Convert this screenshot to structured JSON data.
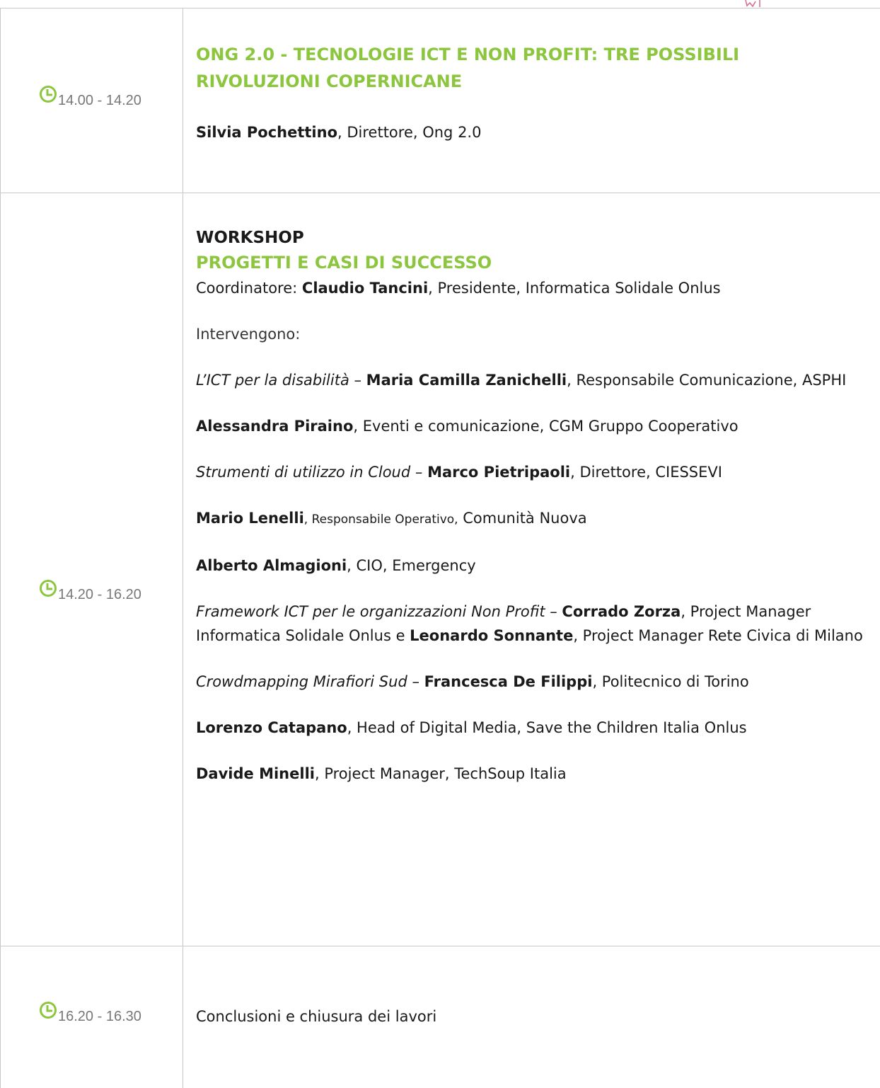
{
  "colors": {
    "accent": "#8cc63f",
    "text": "#1a1a1a",
    "time": "#777777",
    "border": "#c8c8c8"
  },
  "icons": {
    "time": "clock-icon"
  },
  "rows": [
    {
      "time": "14.00 - 14.20",
      "title": "ONG 2.0 - TECNOLOGIE ICT E NON PROFIT: TRE POSSIBILI RIVOLUZIONI COPERNICANE",
      "speaker": {
        "name": "Silvia Pochettino",
        "role": ", Direttore, Ong 2.0"
      }
    },
    {
      "time": "14.20 - 16.20",
      "heading": "WORKSHOP",
      "title": "PROGETTI E CASI DI SUCCESSO",
      "coordinator": {
        "label": "Coordinatore: ",
        "name": "Claudio Tancini",
        "role": ", Presidente, Informatica Solidale Onlus"
      },
      "intro": "Intervengono:",
      "talks": [
        {
          "topic": "L’ICT per la disabilità",
          "sep": " – ",
          "name": "Maria Camilla Zanichelli",
          "role": ", Responsabile Comunicazione, ASPHI"
        },
        {
          "name": "Alessandra Piraino",
          "role": ", Eventi e comunicazione, CGM Gruppo Cooperativo"
        },
        {
          "topic": "Strumenti di utilizzo in Cloud",
          "sep": " – ",
          "name": "Marco Pietripaoli",
          "role": ", Direttore, CIESSEVI"
        },
        {
          "name": "Mario Lenelli",
          "role_small": ", Responsabile Operativo,",
          "role": " Comunità Nuova"
        },
        {
          "name": "Alberto Almagioni",
          "role": ", CIO, Emergency"
        },
        {
          "topic": "Framework ICT per le organizzazioni Non Profit",
          "sep": " – ",
          "name": "Corrado Zorza",
          "role": ", Project Manager Informatica Solidale Onlus e ",
          "name2": "Leonardo Sonnante",
          "role2": ", Project Manager Rete Civica di Milano"
        },
        {
          "topic": "Crowdmapping Mirafiori Sud",
          "sep": " – ",
          "name": "Francesca De Filippi",
          "role": ", Politecnico di Torino"
        },
        {
          "name": "Lorenzo Catapano",
          "role": ", Head of Digital Media, Save the Children Italia Onlus"
        },
        {
          "name": "Davide Minelli",
          "role": ", Project Manager, TechSoup Italia"
        }
      ]
    },
    {
      "time": "16.20 - 16.30",
      "text": "Conclusioni e chiusura dei lavori"
    }
  ]
}
